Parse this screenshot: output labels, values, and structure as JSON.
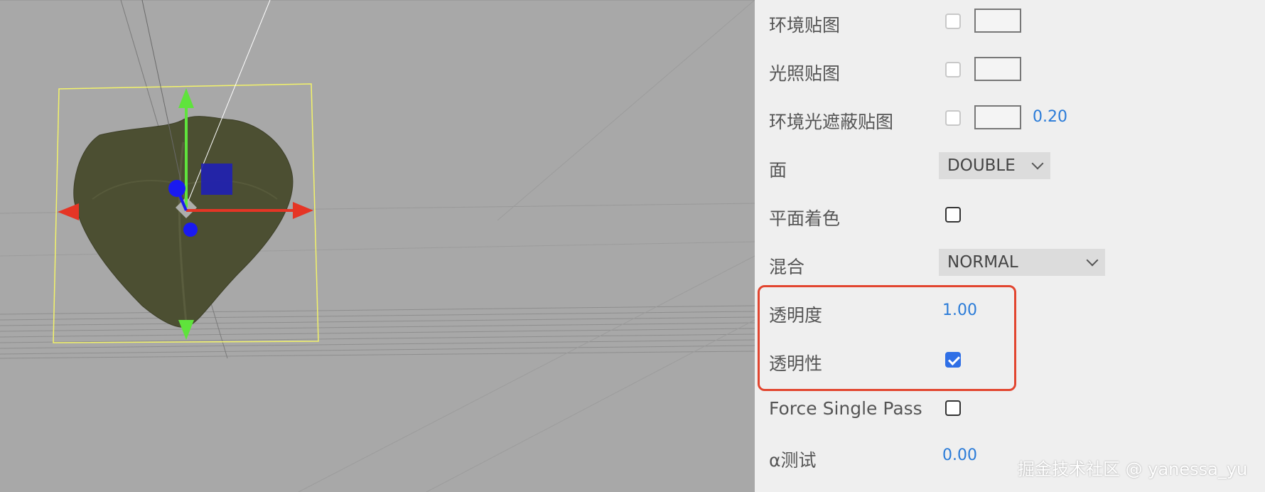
{
  "properties": {
    "env_map": {
      "label": "环境贴图"
    },
    "light_map": {
      "label": "光照贴图"
    },
    "ao_map": {
      "label": "环境光遮蔽贴图",
      "value": "0.20"
    },
    "side": {
      "label": "面",
      "value": "DOUBLE"
    },
    "flat_shading": {
      "label": "平面着色"
    },
    "blending": {
      "label": "混合",
      "value": "NORMAL"
    },
    "opacity": {
      "label": "透明度",
      "value": "1.00"
    },
    "transparent": {
      "label": "透明性",
      "checked": true
    },
    "force_single_pass": {
      "label": "Force Single Pass"
    },
    "alpha_test": {
      "label": "α测试",
      "value": "0.00"
    }
  },
  "watermark": "掘金技术社区 @ yanessa_yu",
  "colors": {
    "accent": "#2f6fe6",
    "number": "#2a7bd8",
    "highlight": "#e2452f",
    "gizmo_x": "#e53525",
    "gizmo_y": "#5fe33c",
    "gizmo_z": "#1a1af0",
    "selection_box": "#f3f36a"
  },
  "icons": [
    "translate-gizmo-icon",
    "chevron-down-icon"
  ]
}
